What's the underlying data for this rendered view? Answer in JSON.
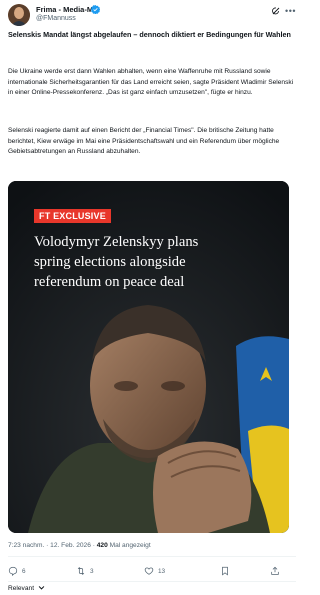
{
  "author": {
    "name": "Frima - Media-Mix",
    "handle": "@FMannuss"
  },
  "tweet": {
    "headline": "Selenskis Mandat längst abgelaufen – dennoch diktiert er Bedingungen für Wahlen",
    "paragraphs": [
      "Die Ukraine werde erst dann Wahlen abhalten, wenn eine Waffenruhe mit Russland sowie internationale Sicherheitsgarantien für das Land erreicht seien, sagte Präsident Wladimir Selenski in einer Online-Pressekonferenz. „Das ist ganz einfach umzusetzen\", fügte er hinzu.",
      "Selenski reagierte damit auf einen Bericht der „Financial Times\". Die britische Zeitung hatte berichtet, Kiew erwäge im Mai eine Präsidentschaftswahl und ein Referendum über mögliche Gebietsabtretungen an Russland abzuhalten."
    ]
  },
  "media": {
    "badge": "FT EXCLUSIVE",
    "headline": "Volodymyr Zelenskyy plans\nspring elections alongside\nreferendum on peace deal"
  },
  "meta": {
    "time": "7:23 nachm.",
    "separator": " · ",
    "date": "12. Feb. 2026",
    "separator2": " · ",
    "views_count": "420",
    "views_label": " Mal angezeigt"
  },
  "actions": {
    "replies": "6",
    "reposts": "3",
    "likes": "13"
  },
  "sort": {
    "label": "Relevant"
  },
  "colors": {
    "badge_red": "#e8372b",
    "secondary_text": "#536471",
    "verified_blue": "#1d9bf0"
  }
}
